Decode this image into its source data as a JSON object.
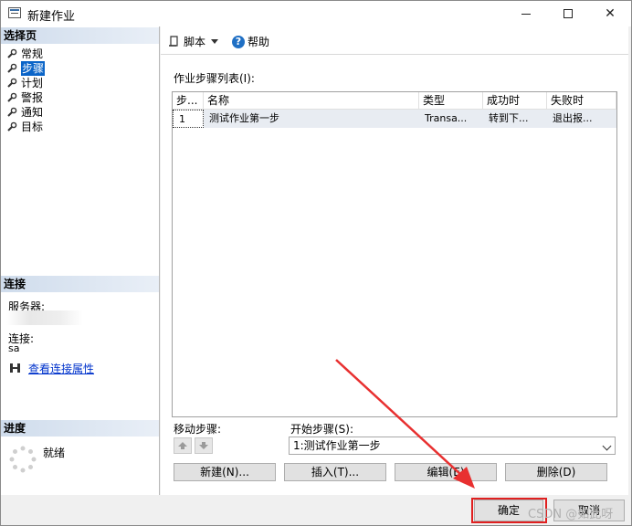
{
  "window": {
    "title": "新建作业"
  },
  "left_pane": {
    "select_page_header": "选择页",
    "pages": [
      {
        "label": "常规",
        "selected": false
      },
      {
        "label": "步骤",
        "selected": true
      },
      {
        "label": "计划",
        "selected": false
      },
      {
        "label": "警报",
        "selected": false
      },
      {
        "label": "通知",
        "selected": false
      },
      {
        "label": "目标",
        "selected": false
      }
    ],
    "connection_header": "连接",
    "server_label": "服务器:",
    "connection_label": "连接:",
    "connection_value": "sa",
    "view_connection_link": "查看连接属性",
    "progress_header": "进度",
    "progress_status": "就绪"
  },
  "toolbar": {
    "script_label": "脚本",
    "help_label": "帮助"
  },
  "steps": {
    "list_label": "作业步骤列表(I):",
    "columns": [
      "步...",
      "名称",
      "类型",
      "成功时",
      "失败时"
    ],
    "rows": [
      {
        "step": "1",
        "name": "测试作业第一步",
        "type": "Transa...",
        "on_success": "转到下...",
        "on_failure": "退出报..."
      }
    ],
    "move_label": "移动步骤:",
    "start_label": "开始步骤(S):",
    "start_value": "1:测试作业第一步",
    "buttons": {
      "new": "新建(N)...",
      "insert": "插入(T)...",
      "edit": "编辑(E)",
      "delete": "删除(D)"
    }
  },
  "footer": {
    "ok": "确定",
    "cancel": "取消"
  },
  "watermark": "CSDN @如此呀",
  "colors": {
    "selection": "#0a64c8",
    "highlight_box": "#e02020",
    "link": "#0033cc"
  }
}
